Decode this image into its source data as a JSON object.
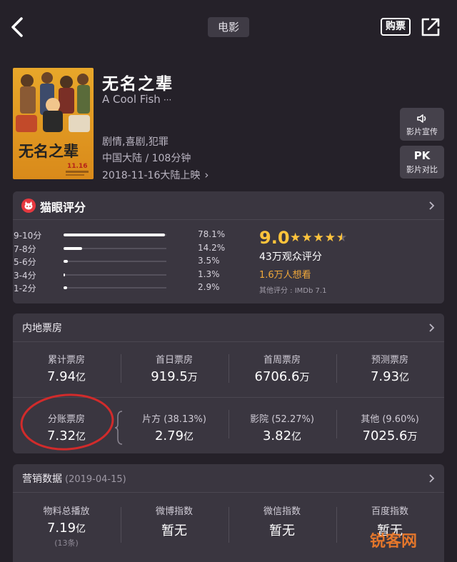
{
  "nav": {
    "title": "电影",
    "buy_label": "购票"
  },
  "movie": {
    "title": "无名之辈",
    "english_title": "A Cool Fish",
    "genres": "剧情,喜剧,犯罪",
    "region_duration": "中国大陆 / 108分钟",
    "release": "2018-11-16大陆上映",
    "poster_text": "无名之辈",
    "poster_date": "11.16"
  },
  "side_buttons": [
    {
      "label": "影片宣传",
      "icon": "speaker-icon"
    },
    {
      "top": "PK",
      "label": "影片对比"
    }
  ],
  "rating": {
    "title": "猫眼评分",
    "score": "9.0",
    "stars": "★★★★★",
    "star_fraction": 0.9,
    "count": "43万观众评分",
    "want_to_see": "1.6万人想看",
    "other": "其他评分 : IMDb 7.1",
    "distribution": [
      {
        "label": "9-10分",
        "pct": "78.1%",
        "value": 78.1
      },
      {
        "label": "7-8分",
        "pct": "14.2%",
        "value": 14.2
      },
      {
        "label": "5-6分",
        "pct": "3.5%",
        "value": 3.5
      },
      {
        "label": "3-4分",
        "pct": "1.3%",
        "value": 1.3
      },
      {
        "label": "1-2分",
        "pct": "2.9%",
        "value": 2.9
      }
    ]
  },
  "box_office": {
    "title": "内地票房",
    "row1": [
      {
        "label": "累计票房",
        "value": "7.94",
        "unit": "亿"
      },
      {
        "label": "首日票房",
        "value": "919.5",
        "unit": "万"
      },
      {
        "label": "首周票房",
        "value": "6706.6",
        "unit": "万"
      },
      {
        "label": "预测票房",
        "value": "7.93",
        "unit": "亿"
      }
    ],
    "row2": [
      {
        "label": "分账票房",
        "value": "7.32",
        "unit": "亿"
      },
      {
        "label": "片方 (38.13%)",
        "value": "2.79",
        "unit": "亿"
      },
      {
        "label": "影院 (52.27%)",
        "value": "3.82",
        "unit": "亿"
      },
      {
        "label": "其他 (9.60%)",
        "value": "7025.6",
        "unit": "万"
      }
    ]
  },
  "marketing": {
    "title": "营销数据",
    "date": "(2019-04-15)",
    "items": [
      {
        "label": "物料总播放",
        "value": "7.19",
        "unit": "亿",
        "note": "(13条)"
      },
      {
        "label": "微博指数",
        "value": "暂无",
        "unit": ""
      },
      {
        "label": "微信指数",
        "value": "暂无",
        "unit": ""
      },
      {
        "label": "百度指数",
        "value": "暂无",
        "unit": ""
      }
    ]
  },
  "watermark": "锐客网",
  "colors": {
    "background": "#252129",
    "card": "#3a3640",
    "accent": "#fdc33b",
    "want": "#f0a83a",
    "circle": "#d12b2b",
    "logo": "#e6383f"
  }
}
